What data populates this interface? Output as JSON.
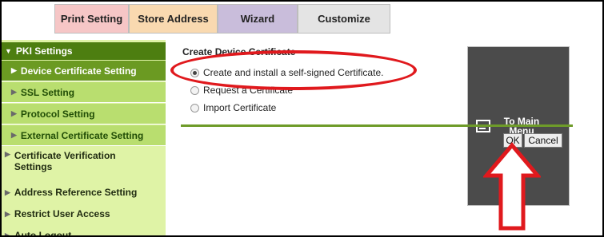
{
  "tabs": {
    "print_setting": "Print Setting",
    "store_address": "Store Address",
    "wizard": "Wizard",
    "customize": "Customize",
    "to_main_menu": "To Main Menu"
  },
  "sidebar": {
    "pki_settings": "PKI Settings",
    "device_certificate_setting": "Device Certificate Setting",
    "ssl_setting": "SSL Setting",
    "protocol_setting": "Protocol Setting",
    "external_certificate_setting": "External Certificate Setting",
    "certificate_verification_settings": "Certificate Verification Settings",
    "address_reference_setting": "Address Reference Setting",
    "restrict_user_access": "Restrict User Access",
    "auto_logout": "Auto Logout"
  },
  "main": {
    "heading": "Create Device Certificate",
    "options": [
      "Create and install a self-signed Certificate.",
      "Request a Certificate",
      "Import Certificate"
    ],
    "selected_option_index": 0,
    "ok_label": "OK",
    "cancel_label": "Cancel"
  },
  "annotation_color": "#e0191d",
  "accent_green": "#4d7e10"
}
